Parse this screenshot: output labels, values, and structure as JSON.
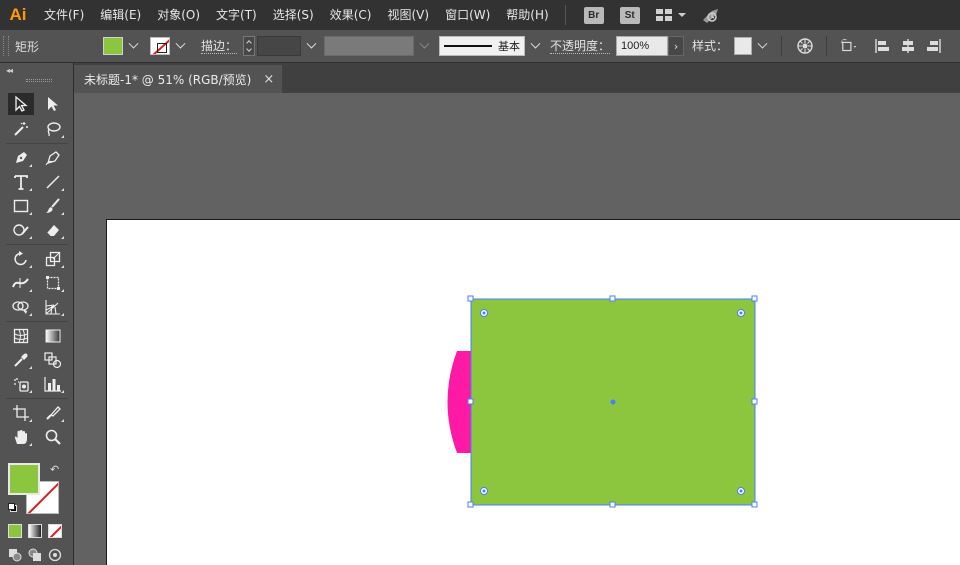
{
  "app": {
    "logo": "Ai"
  },
  "menu": [
    "文件(F)",
    "编辑(E)",
    "对象(O)",
    "文字(T)",
    "选择(S)",
    "效果(C)",
    "视图(V)",
    "窗口(W)",
    "帮助(H)"
  ],
  "app_buttons": {
    "bridge": "Br",
    "stock": "St"
  },
  "control": {
    "tool_name": "矩形",
    "stroke_label": "描边：",
    "stroke_value": "",
    "stroke_style": "基本",
    "opacity_label": "不透明度：",
    "opacity_value": "100%",
    "style_label": "样式："
  },
  "document": {
    "tab_title": "未标题-1* @ 51% (RGB/预览)",
    "close": "×"
  },
  "colors": {
    "fill": "#8cc63f",
    "magenta": "#ff1aa6",
    "selection": "#4a7cff",
    "brand": "#ff9a00"
  },
  "tools": [
    "selection-tool",
    "direct-selection-tool",
    "magic-wand-tool",
    "lasso-tool",
    "pen-tool",
    "curvature-tool",
    "type-tool",
    "line-segment-tool",
    "rectangle-tool",
    "paintbrush-tool",
    "shaper-tool",
    "eraser-tool",
    "rotate-tool",
    "scale-tool",
    "width-tool",
    "free-transform-tool",
    "shape-builder-tool",
    "perspective-grid-tool",
    "mesh-tool",
    "gradient-tool",
    "eyedropper-tool",
    "blend-tool",
    "symbol-sprayer-tool",
    "column-graph-tool",
    "artboard-tool",
    "slice-tool",
    "hand-tool",
    "zoom-tool"
  ]
}
